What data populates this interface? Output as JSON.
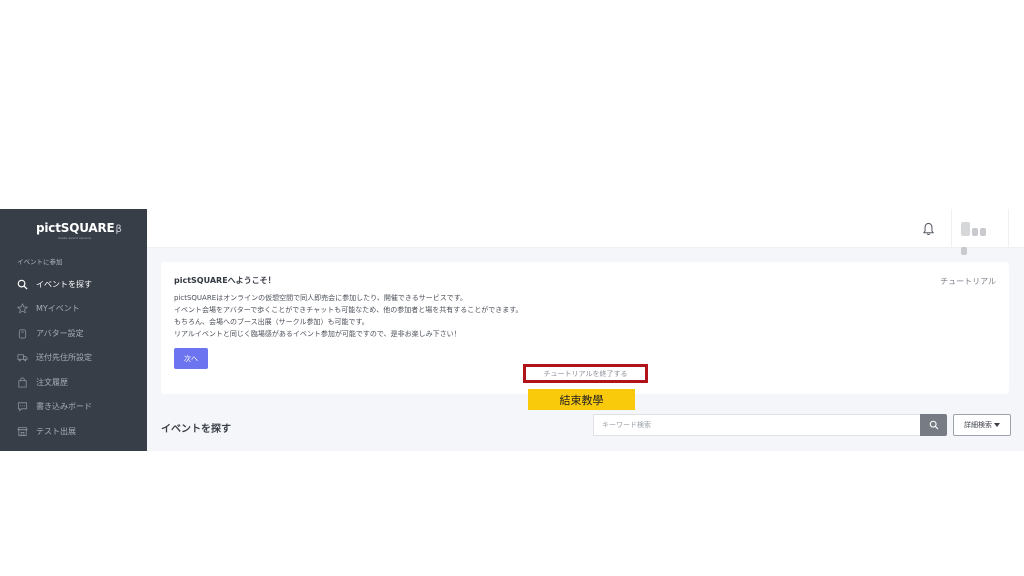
{
  "app": {
    "logo": "pictSQUARE",
    "logo_beta": "β",
    "logo_tagline": "made event service"
  },
  "sidebar": {
    "section_label": "イベントに参加",
    "items": [
      {
        "label": "イベントを探す",
        "icon": "search-icon",
        "active": true
      },
      {
        "label": "MYイベント",
        "icon": "star-icon",
        "active": false
      },
      {
        "label": "アバター設定",
        "icon": "avatar-icon",
        "active": false
      },
      {
        "label": "送付先住所設定",
        "icon": "truck-icon",
        "active": false
      },
      {
        "label": "注文履歴",
        "icon": "bag-icon",
        "active": false
      },
      {
        "label": "書き込みボード",
        "icon": "comment-icon",
        "active": false
      },
      {
        "label": "テスト出展",
        "icon": "shop-icon",
        "active": false
      }
    ]
  },
  "topbar": {
    "bell_icon": "bell-icon",
    "user_name": "(blurred)"
  },
  "tutorial": {
    "title": "pictSQUAREへようこそ！",
    "label": "チュートリアル",
    "lines": [
      "pictSQUAREはオンラインの仮想空間で同人即売会に参加したり、開催できるサービスです。",
      "イベント会場をアバターで歩くことができチャットも可能なため、他の参加者と場を共有することができます。",
      "もちろん、会場へのブース出展（サークル参加）も可能です。",
      "リアルイベントと同じく臨場感があるイベント参加が可能ですので、是非お楽しみ下さい！"
    ],
    "next_button": "次へ",
    "end_button": "チュートリアルを終了する"
  },
  "annotation": {
    "text": "結束教學",
    "color": "#f9c90c"
  },
  "search": {
    "title": "イベントを探す",
    "placeholder": "キーワード検索",
    "detail_button": "詳細検索"
  },
  "colors": {
    "sidebar_bg": "#383e48",
    "accent": "#6c74f0",
    "highlight_border": "#b0141a"
  }
}
